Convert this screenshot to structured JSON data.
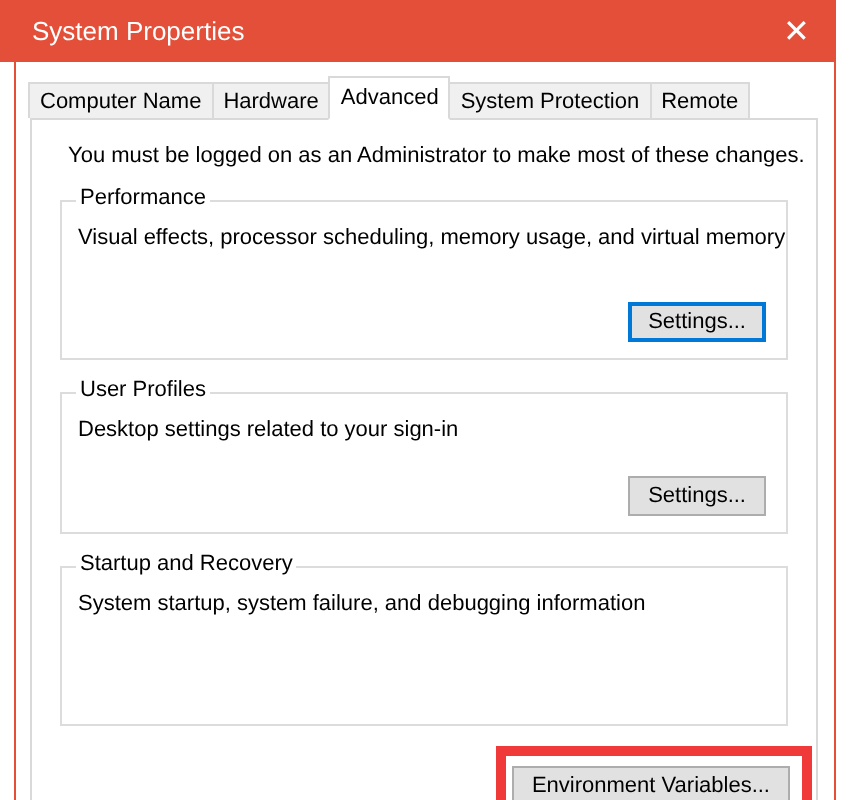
{
  "window": {
    "title": "System Properties",
    "close": "✕"
  },
  "tabs": [
    {
      "label": "Computer Name",
      "selected": false
    },
    {
      "label": "Hardware",
      "selected": false
    },
    {
      "label": "Advanced",
      "selected": true
    },
    {
      "label": "System Protection",
      "selected": false
    },
    {
      "label": "Remote",
      "selected": false
    }
  ],
  "notice": "You must be logged on as an Administrator to make most of these changes.",
  "groups": [
    {
      "title": "Performance",
      "description": "Visual effects, processor scheduling, memory usage, and virtual memory",
      "button": {
        "label": "Settings...",
        "focused": true
      }
    },
    {
      "title": "User Profiles",
      "description": "Desktop settings related to your sign-in",
      "button": {
        "label": "Settings...",
        "focused": false
      }
    },
    {
      "title": "Startup and Recovery",
      "description": "System startup, system failure, and debugging information"
    }
  ],
  "env_button": {
    "label": "Environment Variables...",
    "highlighted": true
  }
}
